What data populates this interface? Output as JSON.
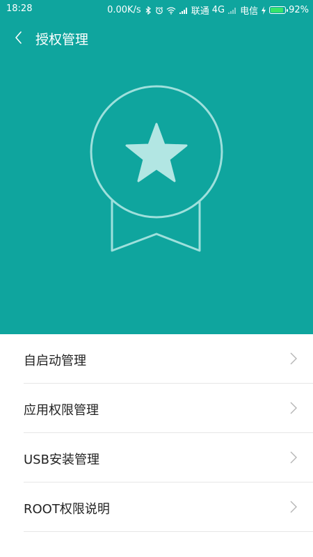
{
  "status_bar": {
    "time": "18:28",
    "network_speed": "0.00K/s",
    "carrier1": "联通",
    "network_type": "4G",
    "carrier2": "电信",
    "battery_percent": "92%",
    "battery_level": 0.92
  },
  "header": {
    "title": "授权管理",
    "background_color": "#0fa59e"
  },
  "list": {
    "items": [
      {
        "label": "自启动管理"
      },
      {
        "label": "应用权限管理"
      },
      {
        "label": "USB安装管理"
      },
      {
        "label": "ROOT权限说明"
      }
    ]
  }
}
